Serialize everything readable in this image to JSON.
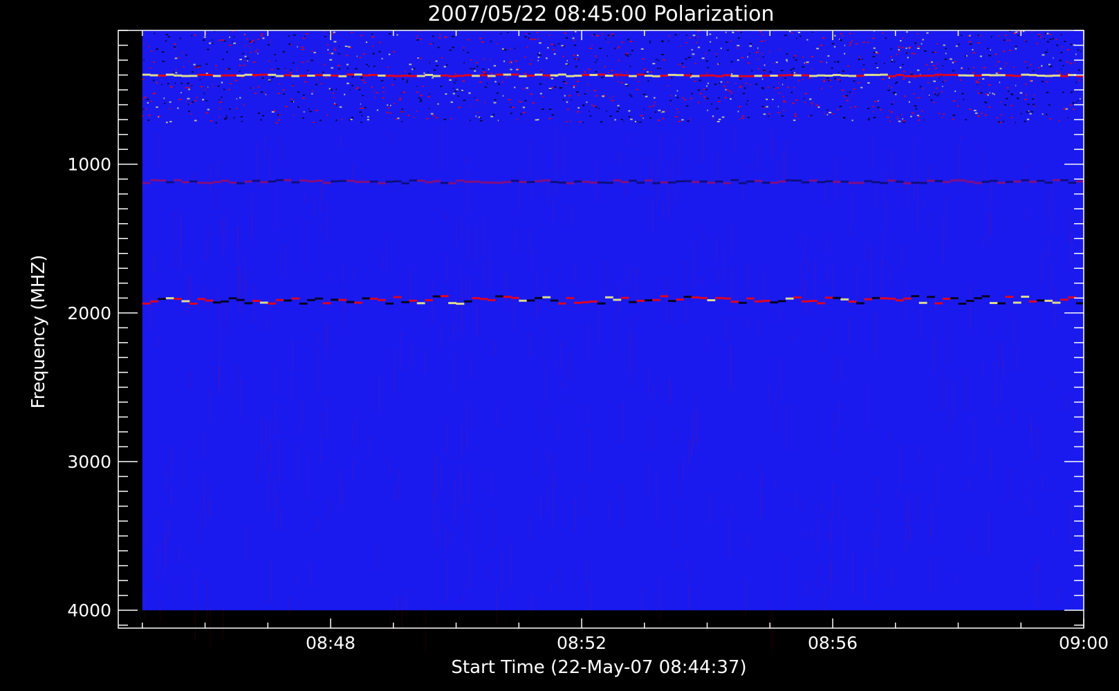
{
  "chart_data": {
    "type": "heatmap",
    "title": "2007/05/22 08:45:00 Polarization",
    "xlabel": "Start Time (22-May-07 08:44:37)",
    "ylabel": "Frequency (MHZ)",
    "x_axis": {
      "range": [
        "08:44:37",
        "09:00:00"
      ],
      "tick_labels": [
        "08:48",
        "08:52",
        "08:56",
        "09:00"
      ],
      "tick_values": [
        "08:48",
        "08:52",
        "08:56",
        "09:00"
      ],
      "minor_interval_minutes": 1
    },
    "y_axis": {
      "range": [
        100,
        4120
      ],
      "reversed": true,
      "tick_values": [
        1000,
        2000,
        3000,
        4000
      ],
      "tick_labels": [
        "1000",
        "2000",
        "3000",
        "4000"
      ],
      "minor_interval": 100
    },
    "data_time_range": [
      "08:45:00",
      "09:00:00"
    ],
    "data_freq_range": [
      100,
      4000
    ],
    "colormap": [
      "#000000",
      "#0000ff",
      "#ff0000",
      "#ffff80"
    ],
    "background_color": "#1a1aee",
    "bands": [
      {
        "freq_start": 100,
        "freq_end": 720,
        "description": "noisy"
      },
      {
        "freq_start": 390,
        "freq_end": 420,
        "description": "bright red-yellow line"
      },
      {
        "freq_start": 1100,
        "freq_end": 1140,
        "description": "faint red line"
      },
      {
        "freq_start": 1880,
        "freq_end": 1950,
        "description": "red and black features"
      }
    ],
    "axis_color": "#ffffff"
  }
}
